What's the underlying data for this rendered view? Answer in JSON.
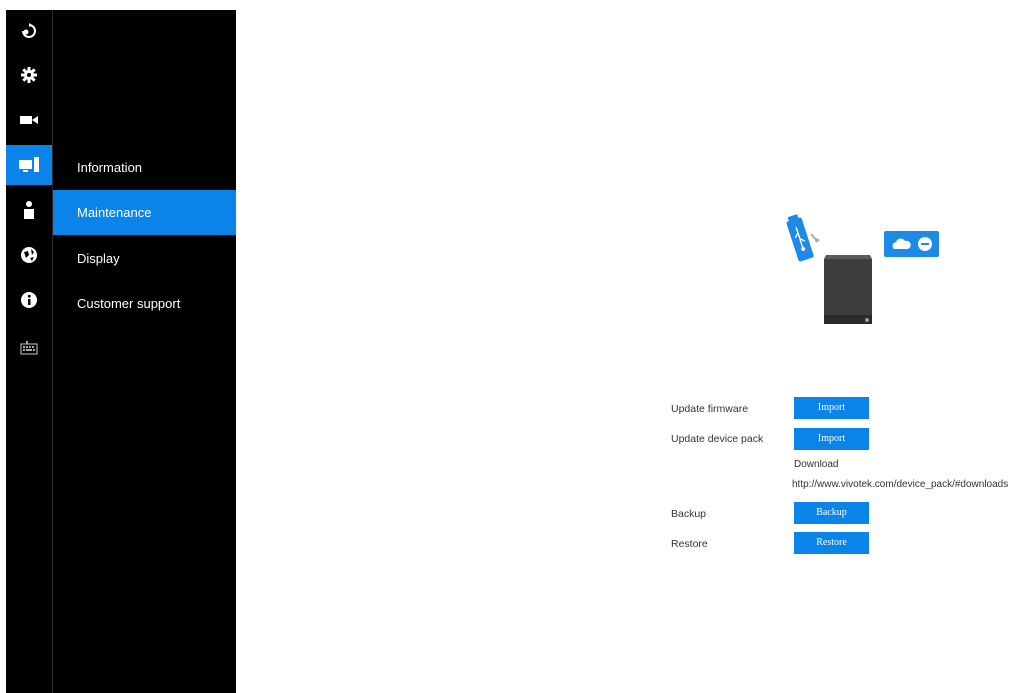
{
  "sidebar": {
    "icons": [
      {
        "name": "logo-icon",
        "active": false
      },
      {
        "name": "gear-icon",
        "active": false
      },
      {
        "name": "video-camera-icon",
        "active": false
      },
      {
        "name": "system-icon",
        "active": true
      },
      {
        "name": "user-icon",
        "active": false
      },
      {
        "name": "network-icon",
        "active": false
      },
      {
        "name": "info-icon",
        "active": false
      },
      {
        "name": "keyboard-icon",
        "active": false
      }
    ],
    "accent_color": "#0a84e8"
  },
  "menu": {
    "items": [
      {
        "label": "Information"
      },
      {
        "label": "Maintenance"
      },
      {
        "label": "Display"
      },
      {
        "label": "Customer support"
      }
    ],
    "active_item": "Maintenance"
  },
  "maintenance": {
    "update_firmware": {
      "label": "Update firmware",
      "button": "Import"
    },
    "update_device_pack": {
      "label": "Update device pack",
      "button": "Import"
    },
    "download_label": "Download",
    "download_url": "http://www.vivotek.com/device_pack/#downloads",
    "backup": {
      "label": "Backup",
      "button": "Backup"
    },
    "restore": {
      "label": "Restore",
      "button": "Restore"
    }
  }
}
